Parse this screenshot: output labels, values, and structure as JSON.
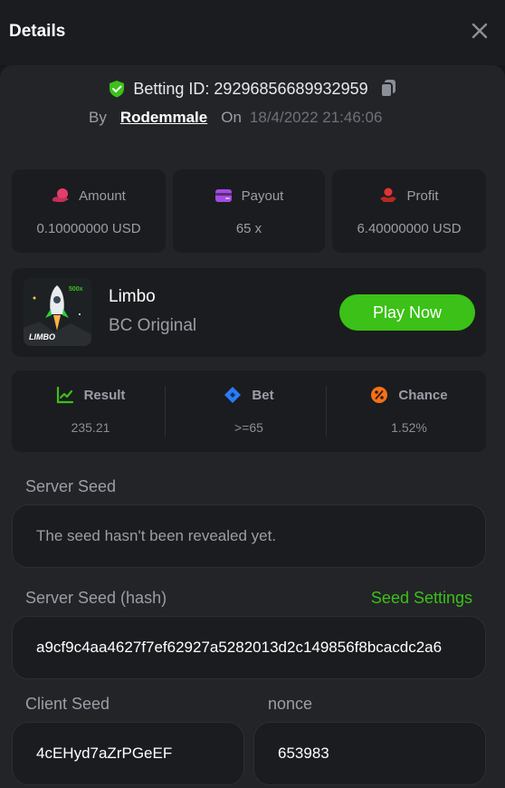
{
  "header": {
    "title": "Details"
  },
  "bet": {
    "id_text": "Betting ID: 29296856689932959",
    "by_label": "By",
    "user": "Rodemmale",
    "on_label": "On",
    "date": "18/4/2022 21:46:06"
  },
  "stats": [
    {
      "label": "Amount",
      "value": "0.10000000 USD",
      "icon": "coins-icon",
      "color": "#e23d6b"
    },
    {
      "label": "Payout",
      "value": "65 x",
      "icon": "wallet-icon",
      "color": "#a24de0"
    },
    {
      "label": "Profit",
      "value": "6.40000000 USD",
      "icon": "hand-coin-icon",
      "color": "#e0362f"
    }
  ],
  "game": {
    "name": "Limbo",
    "subtitle": "BC Original",
    "play_label": "Play Now",
    "thumb_text": "LIMBO",
    "thumb_badge": "500x"
  },
  "results": [
    {
      "label": "Result",
      "value": "235.21",
      "icon": "result-chart-icon",
      "color": "#3bc117"
    },
    {
      "label": "Bet",
      "value": ">=65",
      "icon": "ticket-icon",
      "color": "#2a7bf5"
    },
    {
      "label": "Chance",
      "value": "1.52%",
      "icon": "percent-icon",
      "color": "#f2711c"
    }
  ],
  "server_seed": {
    "label": "Server Seed",
    "value": "The seed hasn't been revealed yet."
  },
  "server_hash": {
    "label": "Server Seed (hash)",
    "settings_label": "Seed Settings",
    "value": "a9cf9c4aa4627f7ef62927a5282013d2c149856f8bcacdc2a6"
  },
  "client_seed": {
    "label": "Client Seed",
    "value": "4cEHyd7aZrPGeEF"
  },
  "nonce": {
    "label": "nonce",
    "value": "653983"
  },
  "colors": {
    "accent": "#3bc117",
    "panel": "#232428",
    "card": "#1b1c1f"
  }
}
